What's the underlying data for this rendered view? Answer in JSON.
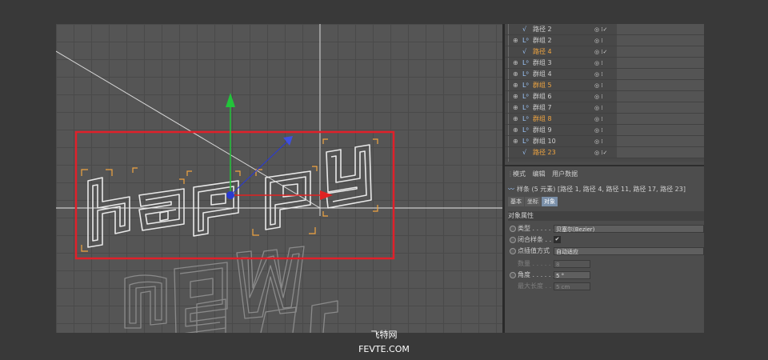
{
  "object_tree": {
    "rows": [
      {
        "type": "path",
        "label": "路径 2",
        "highlight": false,
        "check": true
      },
      {
        "type": "group",
        "label": "群组 2",
        "highlight": false,
        "check": false
      },
      {
        "type": "path",
        "label": "路径 4",
        "highlight": true,
        "check": true
      },
      {
        "type": "group",
        "label": "群组 3",
        "highlight": false,
        "check": false
      },
      {
        "type": "group",
        "label": "群组 4",
        "highlight": false,
        "check": false
      },
      {
        "type": "group",
        "label": "群组 5",
        "highlight": true,
        "check": false
      },
      {
        "type": "group",
        "label": "群组 6",
        "highlight": false,
        "check": false
      },
      {
        "type": "group",
        "label": "群组 7",
        "highlight": false,
        "check": false
      },
      {
        "type": "group",
        "label": "群组 8",
        "highlight": true,
        "check": false
      },
      {
        "type": "group",
        "label": "群组 9",
        "highlight": false,
        "check": false
      },
      {
        "type": "group",
        "label": "群组 10",
        "highlight": false,
        "check": false
      },
      {
        "type": "path",
        "label": "路径 23",
        "highlight": true,
        "check": true
      }
    ]
  },
  "attributes": {
    "menu": [
      "模式",
      "编辑",
      "用户数据"
    ],
    "object_line": "样条 (5 元素) [路径 1, 路径 4, 路径 11, 路径 17, 路径 23]",
    "tabs": [
      "基本",
      "坐标",
      "对象"
    ],
    "active_tab": 2,
    "section_title": "对象属性",
    "props": {
      "type_label": "类型 . . . . . . .",
      "type_value": "贝塞尔(Bezier)",
      "close_label": "闭合样条 . .",
      "close_check": "✔",
      "interp_label": "点插值方式",
      "interp_value": "自动适应",
      "count_label": "数量 . . . . . . .",
      "count_value": "8",
      "angle_label": "角度 . . . . . . .",
      "angle_value": "5 °",
      "maxlen_label": "最大长度 . . .",
      "maxlen_value": "5 cm"
    }
  },
  "watermark": {
    "cn": "飞特网",
    "en": "FEVTE.COM"
  },
  "colors": {
    "highlight": "#f0a541",
    "selection_box": "#e0202a",
    "gizmo_y": "#22c43a",
    "gizmo_x": "#e02222",
    "gizmo_z": "#2a3ad0"
  },
  "icons": {
    "path": "spline-icon",
    "group": "null-group-icon",
    "expand": "expand-toggle-icon"
  }
}
